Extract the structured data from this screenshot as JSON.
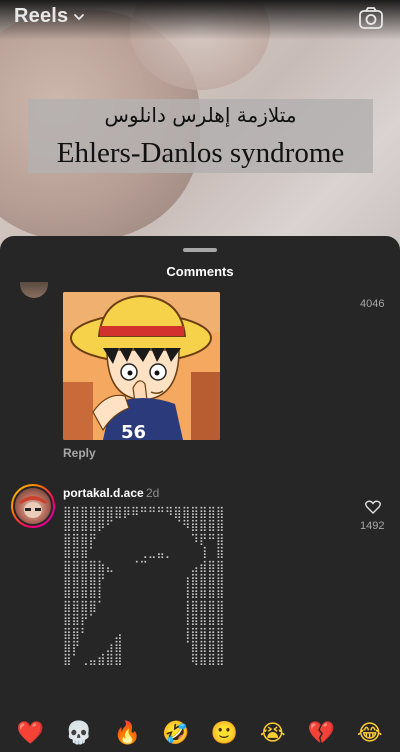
{
  "header": {
    "title": "Reels"
  },
  "reel": {
    "caption_arabic": "متلازمة إهلرس دانلوس",
    "caption_english": "Ehlers-Danlos syndrome"
  },
  "comments_sheet": {
    "title": "Comments",
    "comments": [
      {
        "likes": "4046",
        "reply_label": "Reply",
        "media": "gif-straw-hat-boy"
      },
      {
        "username": "portakal.d.ace",
        "time": "2d",
        "likes": "1492",
        "text_lines": [
          "⣿⣿⣿⣿⣿⣿⣿⡿⠿⠛⠛⠛⠻⣿⣿⣿⣿⣿⣿",
          "⣿⣿⣿⣿⡿⠋⠀⠀⠀⠀⠀⠀⠀⠈⠻⣿⣿⣿⣿",
          "⣿⣿⣿⡟⠀⠀⠀⠀⠀⠀⠀⠀⠀⠀⠀⠹⡟⠛⣿",
          "⣿⣿⣿⠁⠀⠀⠀⠀⠀⢀⣀⣤⡀⠀⠀⠀⢸⠀⣿",
          "⣿⣿⣿⣿⣷⣄⠀⠀⠈⠉⠀⠀⠀⠀⠀⣠⣾⣿⣿",
          "⣿⣿⣿⣿⡟⠀⠀⠀⠀⠀⠀⠀⠀⠀⢰⣿⣿⣿⣿",
          "⣿⣿⣿⣿⡇⠀⠀⠀⠀⠀⠀⠀⠀⠀⢸⣿⣿⣿⣿",
          "⣿⣿⣿⣿⠁⠀⠀⠀⠀⠀⠀⠀⠀⠀⢸⣿⣿⣿⣿",
          "⣿⣿⡟⠁⠀⠀⠀⠀⠀⠀⠀⠀⠀⠀⢸⣿⣿⣿⣿",
          "⣿⣿⠃⠀⠀⠀⣠⠀⠀⠀⠀⠀⠀⠀⢸⣿⣿⣿⣿",
          "⣿⡟⠀⠀⠀⣰⣿⠀⠀⠀⠀⠀⠀⠀⠈⣿⣿⣿⣿",
          "⣿⠁⢀⣤⣾⣿⣿⠀⠀⠀⠀⠀⠀⠀⠀⢿⣿⣿⣿"
        ]
      }
    ]
  },
  "reactions": [
    "❤️",
    "💀",
    "🔥",
    "🤣",
    "🙂",
    "😭",
    "💔",
    "😂"
  ]
}
